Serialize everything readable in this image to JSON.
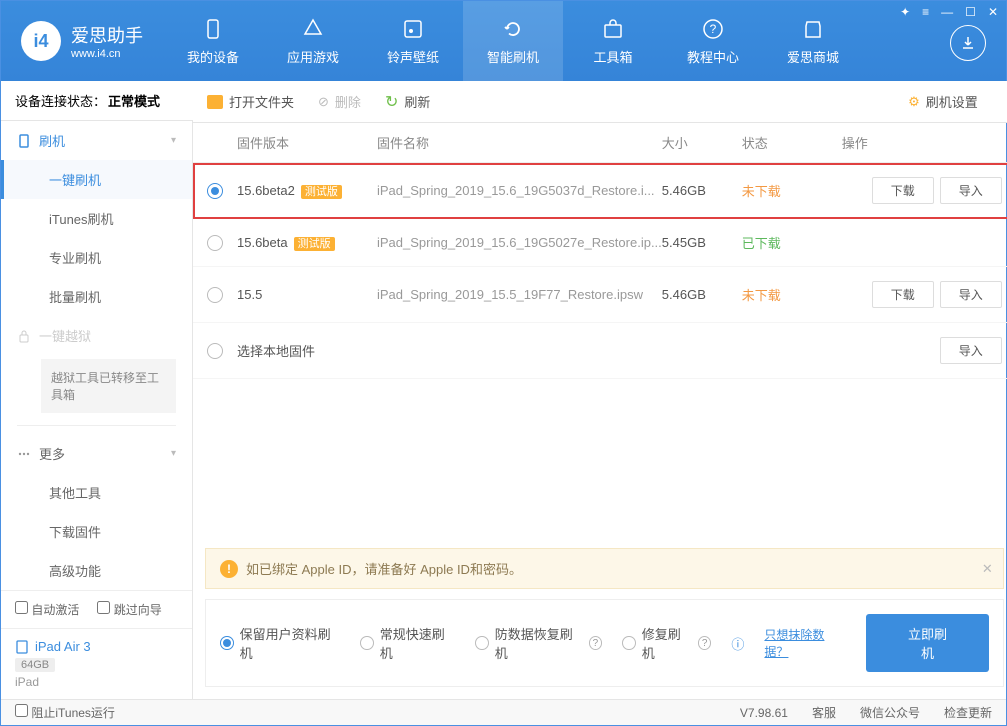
{
  "app": {
    "name": "爱思助手",
    "url": "www.i4.cn"
  },
  "window_controls": [
    "≡",
    "⬚",
    "—",
    "☐",
    "✕"
  ],
  "nav": [
    {
      "label": "我的设备",
      "icon": "device"
    },
    {
      "label": "应用游戏",
      "icon": "apps"
    },
    {
      "label": "铃声壁纸",
      "icon": "media"
    },
    {
      "label": "智能刷机",
      "icon": "refresh",
      "active": true
    },
    {
      "label": "工具箱",
      "icon": "toolbox"
    },
    {
      "label": "教程中心",
      "icon": "help"
    },
    {
      "label": "爱思商城",
      "icon": "store"
    }
  ],
  "status": {
    "label": "设备连接状态：",
    "value": "正常模式"
  },
  "toolbar": {
    "open": "打开文件夹",
    "delete": "删除",
    "refresh": "刷新",
    "settings": "刷机设置"
  },
  "sidebar": {
    "flash": {
      "title": "刷机",
      "items": [
        "一键刷机",
        "iTunes刷机",
        "专业刷机",
        "批量刷机"
      ]
    },
    "jailbreak": {
      "title": "一键越狱",
      "note": "越狱工具已转移至工具箱"
    },
    "more": {
      "title": "更多",
      "items": [
        "其他工具",
        "下载固件",
        "高级功能"
      ]
    },
    "auto_activate": "自动激活",
    "skip_guide": "跳过向导",
    "device": {
      "name": "iPad Air 3",
      "storage": "64GB",
      "type": "iPad"
    }
  },
  "table": {
    "headers": {
      "version": "固件版本",
      "name": "固件名称",
      "size": "大小",
      "status": "状态",
      "action": "操作"
    },
    "rows": [
      {
        "checked": true,
        "highlighted": true,
        "version": "15.6beta2",
        "beta": true,
        "name": "iPad_Spring_2019_15.6_19G5037d_Restore.i...",
        "size": "5.46GB",
        "status": "未下载",
        "status_class": "notdl",
        "download": true,
        "import": true
      },
      {
        "checked": false,
        "version": "15.6beta",
        "beta": true,
        "name": "iPad_Spring_2019_15.6_19G5027e_Restore.ip...",
        "size": "5.45GB",
        "status": "已下载",
        "status_class": "dl"
      },
      {
        "checked": false,
        "version": "15.5",
        "beta": false,
        "name": "iPad_Spring_2019_15.5_19F77_Restore.ipsw",
        "size": "5.46GB",
        "status": "未下载",
        "status_class": "notdl",
        "download": true,
        "import": true
      },
      {
        "checked": false,
        "version": "选择本地固件",
        "local": true,
        "import": true
      }
    ],
    "btn_download": "下载",
    "btn_import": "导入"
  },
  "banner": "如已绑定 Apple ID，请准备好 Apple ID和密码。",
  "options": {
    "items": [
      "保留用户资料刷机",
      "常规快速刷机",
      "防数据恢复刷机",
      "修复刷机"
    ],
    "erase_link": "只想抹除数据？",
    "flash_now": "立即刷机"
  },
  "footer": {
    "block_itunes": "阻止iTunes运行",
    "version": "V7.98.61",
    "service": "客服",
    "wechat": "微信公众号",
    "update": "检查更新"
  },
  "beta_label": "测试版"
}
